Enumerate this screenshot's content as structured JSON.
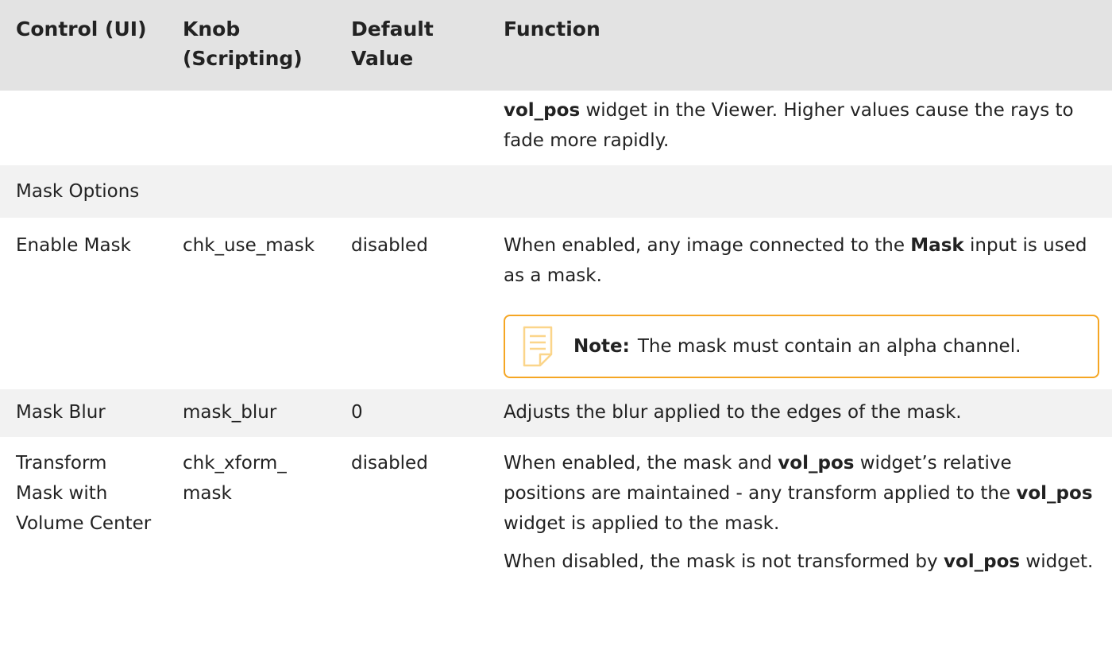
{
  "table": {
    "headers": {
      "control": "Control (UI)",
      "knob": "Knob (Scripting)",
      "default": "Default Value",
      "function": "Function"
    },
    "continuation_row": {
      "bold": "vol_pos",
      "text": " widget in the Viewer. Higher values cause the rays to fade more rapidly."
    },
    "section_title": "Mask Options",
    "rows": [
      {
        "control": "Enable Mask",
        "knob": "chk_use_mask",
        "default": "disabled",
        "function": {
          "t1": "When enabled, any image connected to the ",
          "b1": "Mask",
          "t2": " input is used as a mask."
        },
        "note": {
          "icon": "note-icon",
          "label": "Note:",
          "text": "The mask must contain an alpha channel."
        }
      },
      {
        "control": "Mask Blur",
        "knob": "mask_blur",
        "default": "0",
        "function": {
          "t1": "Adjusts the blur applied to the edges of the mask."
        }
      },
      {
        "control": "Transform Mask with Volume Center",
        "knob": "chk_xform_ mask",
        "default": "disabled",
        "function": {
          "p1_t1": "When enabled, the mask and ",
          "p1_b1": "vol_pos",
          "p1_t2": " widget’s relative positions are maintained - any transform applied to the ",
          "p1_b2": "vol_pos",
          "p1_t3": " widget is applied to the mask.",
          "p2_t1": "When disabled, the mask is not transformed by ",
          "p2_b1": "vol_pos",
          "p2_t2": " widget."
        }
      }
    ],
    "colors": {
      "header_bg": "#e3e3e3",
      "row_grey": "#f2f2f2",
      "row_white": "#ffffff",
      "note_border": "#f5a623",
      "note_icon": "#fbd58a",
      "text": "#222222"
    }
  }
}
